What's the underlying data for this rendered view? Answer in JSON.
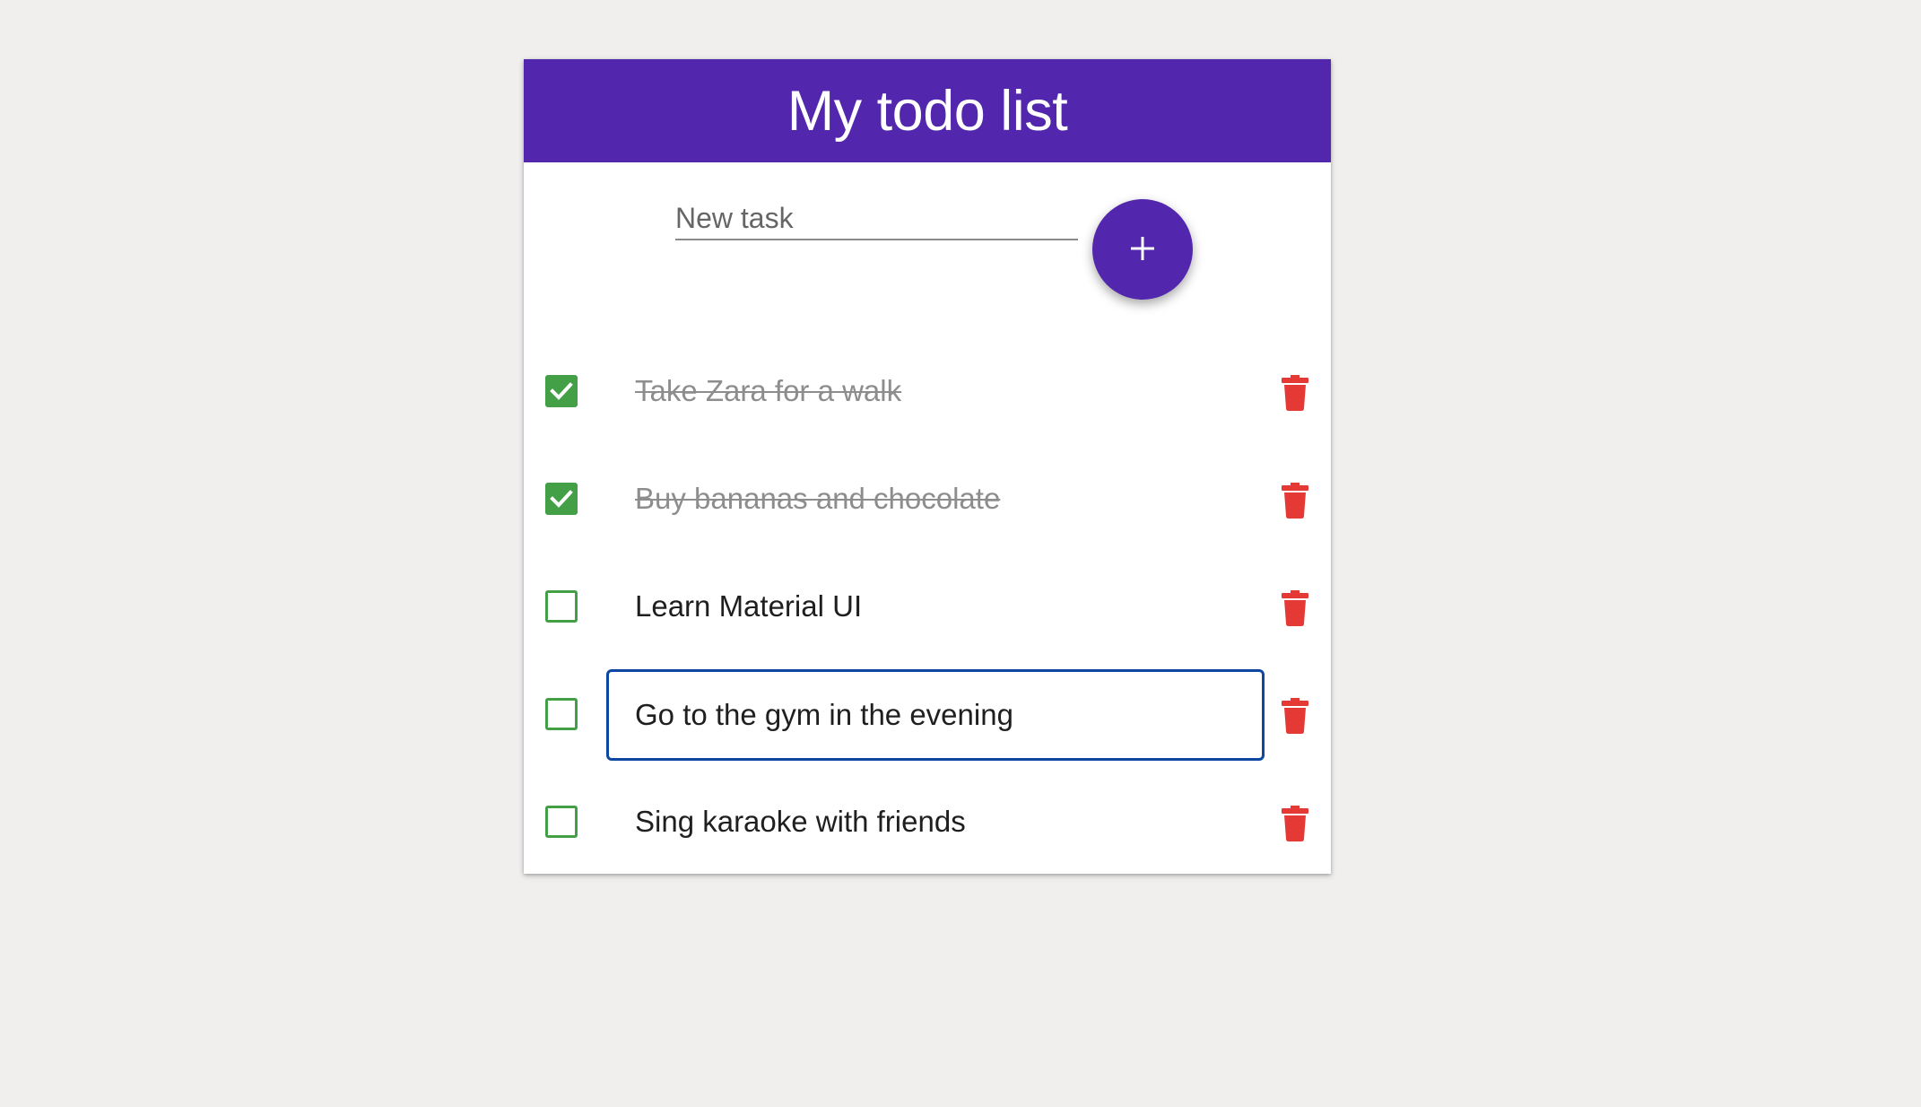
{
  "title": "My todo list",
  "colors": {
    "primary": "#5226ad",
    "check_green": "#43a047",
    "delete_red": "#e53935",
    "edit_border": "#0d47a1"
  },
  "new_task": {
    "placeholder": "New task",
    "value": "",
    "add_icon": "plus-icon"
  },
  "tasks": [
    {
      "text": "Take Zara for a walk",
      "completed": true,
      "editing": false
    },
    {
      "text": "Buy bananas and chocolate",
      "completed": true,
      "editing": false
    },
    {
      "text": "Learn Material UI",
      "completed": false,
      "editing": false
    },
    {
      "text": "Go to the gym in the evening",
      "completed": false,
      "editing": true
    },
    {
      "text": "Sing karaoke with friends",
      "completed": false,
      "editing": false
    }
  ],
  "icons": {
    "check": "checkmark-icon",
    "delete": "trash-icon",
    "add": "plus-icon"
  }
}
